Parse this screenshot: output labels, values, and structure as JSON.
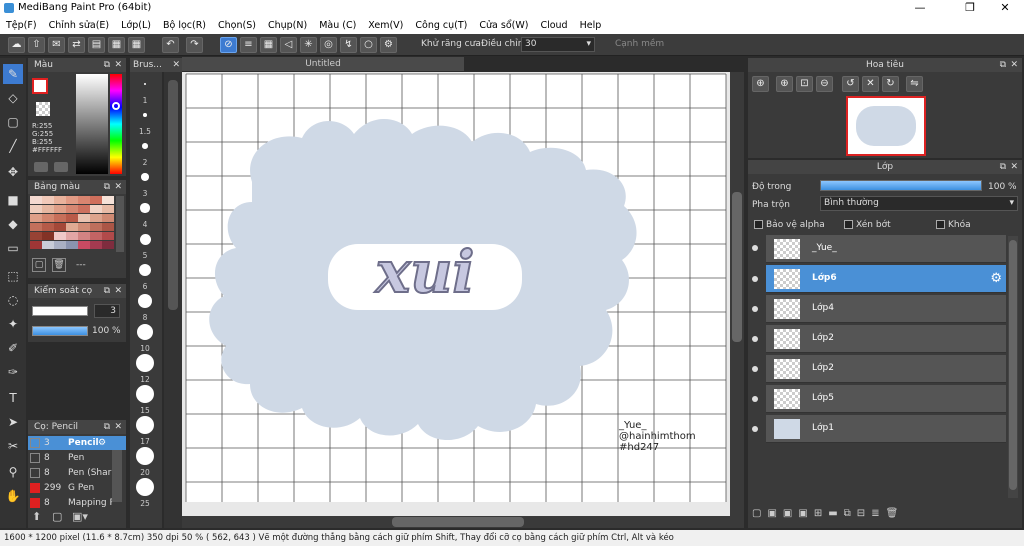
{
  "window": {
    "title": "MediBang Paint Pro (64bit)",
    "min": "—",
    "max": "❐",
    "close": "✕"
  },
  "menu": [
    "Tệp(F)",
    "Chỉnh sửa(E)",
    "Lớp(L)",
    "Bộ lọc(R)",
    "Chọn(S)",
    "Chụp(N)",
    "Màu (C)",
    "Xem(V)",
    "Công cụ(T)",
    "Cửa sổ(W)",
    "Cloud",
    "Help"
  ],
  "toolbar": {
    "antialias_label": "Khử răng cưa",
    "adjust_label": "Điều chỉnh",
    "adjust_value": "30",
    "edge_label": "Cạnh mềm"
  },
  "color_panel": {
    "title": "Màu",
    "r": "R:255",
    "g": "G:255",
    "b": "B:255",
    "hex": "#FFFFFF",
    "fg": "#ffffff",
    "bg": "#ffffff"
  },
  "palette_panel": {
    "title": "Bảng màu",
    "value": "---",
    "colors": [
      "#f4d9d0",
      "#f1c9b9",
      "#e9b29c",
      "#e29b85",
      "#d98570",
      "#cf6f5c",
      "#f6e2d8",
      "#eecdbd",
      "#e6b7a1",
      "#df9f88",
      "#d68772",
      "#cc705e",
      "#f1d3c5",
      "#e8bba6",
      "#de9f88",
      "#d3866f",
      "#c76f5a",
      "#b95a48",
      "#e9c2b0",
      "#dda48d",
      "#d08a73",
      "#c3705c",
      "#b55a48",
      "#a44838",
      "#e0aa93",
      "#d08c76",
      "#be6f5c",
      "#ab5646",
      "#974234",
      "#833226",
      "#f0c8c8",
      "#e2a5a5",
      "#d28383",
      "#c26464",
      "#b14a4a",
      "#9e3636",
      "#c8ccd8",
      "#a9b0c4",
      "#8a94b0",
      "#c94a62",
      "#a43a50",
      "#7f2c3e"
    ]
  },
  "control_panel": {
    "title": "Kiểm soát cọ",
    "size_value": "3",
    "opacity_value": "100 %",
    "opacity": 1.0
  },
  "brush_panel": {
    "title": "Cọ: Pencil",
    "brushes": [
      {
        "size": "3",
        "name": "Pencil",
        "color": "#2a2a2a"
      },
      {
        "size": "8",
        "name": "Pen",
        "color": "#2a2a2a"
      },
      {
        "size": "8",
        "name": "Pen (Sharp)",
        "color": "#2a2a2a"
      },
      {
        "size": "299",
        "name": "G Pen",
        "color": "#e02020"
      },
      {
        "size": "8",
        "name": "Mapping P",
        "color": "#e02020"
      }
    ]
  },
  "brush_size_panel": {
    "title": "Brus...",
    "sizes": [
      "1",
      "1.5",
      "2",
      "3",
      "4",
      "5",
      "6",
      "8",
      "10",
      "12",
      "15",
      "17",
      "20",
      "25"
    ]
  },
  "document": {
    "tab": "Untitled",
    "signature": [
      "_Yue_",
      "@hainhimthom",
      "#hd247"
    ],
    "art_text": "xui"
  },
  "navigator": {
    "title": "Hoa tiêu"
  },
  "layer_panel": {
    "title": "Lớp",
    "opacity_label": "Độ trong",
    "opacity_value": "100 %",
    "opacity": 1.0,
    "blend_label": "Pha trộn",
    "blend_value": "Bình thường",
    "protect_alpha": "Bảo vệ alpha",
    "clipping": "Xén bớt",
    "lock": "Khóa",
    "layers": [
      {
        "name": "_Yue_",
        "selected": false
      },
      {
        "name": "Lớp6",
        "selected": true
      },
      {
        "name": "Lớp4",
        "selected": false
      },
      {
        "name": "Lớp2",
        "selected": false
      },
      {
        "name": "Lớp2",
        "selected": false
      },
      {
        "name": "Lớp5",
        "selected": false
      },
      {
        "name": "Lớp1",
        "selected": false
      }
    ]
  },
  "status": {
    "size": "1600 * 1200 pixel",
    "cm": "(11.6 * 8.7cm)",
    "dpi": "350 dpi",
    "zoom": "50 %",
    "coords": "( 562, 643 )",
    "hint": "Vẽ một đường thẳng bằng cách giữ phím Shift, Thay đổi cỡ cọ bằng cách giữ phím Ctrl, Alt và kéo"
  }
}
